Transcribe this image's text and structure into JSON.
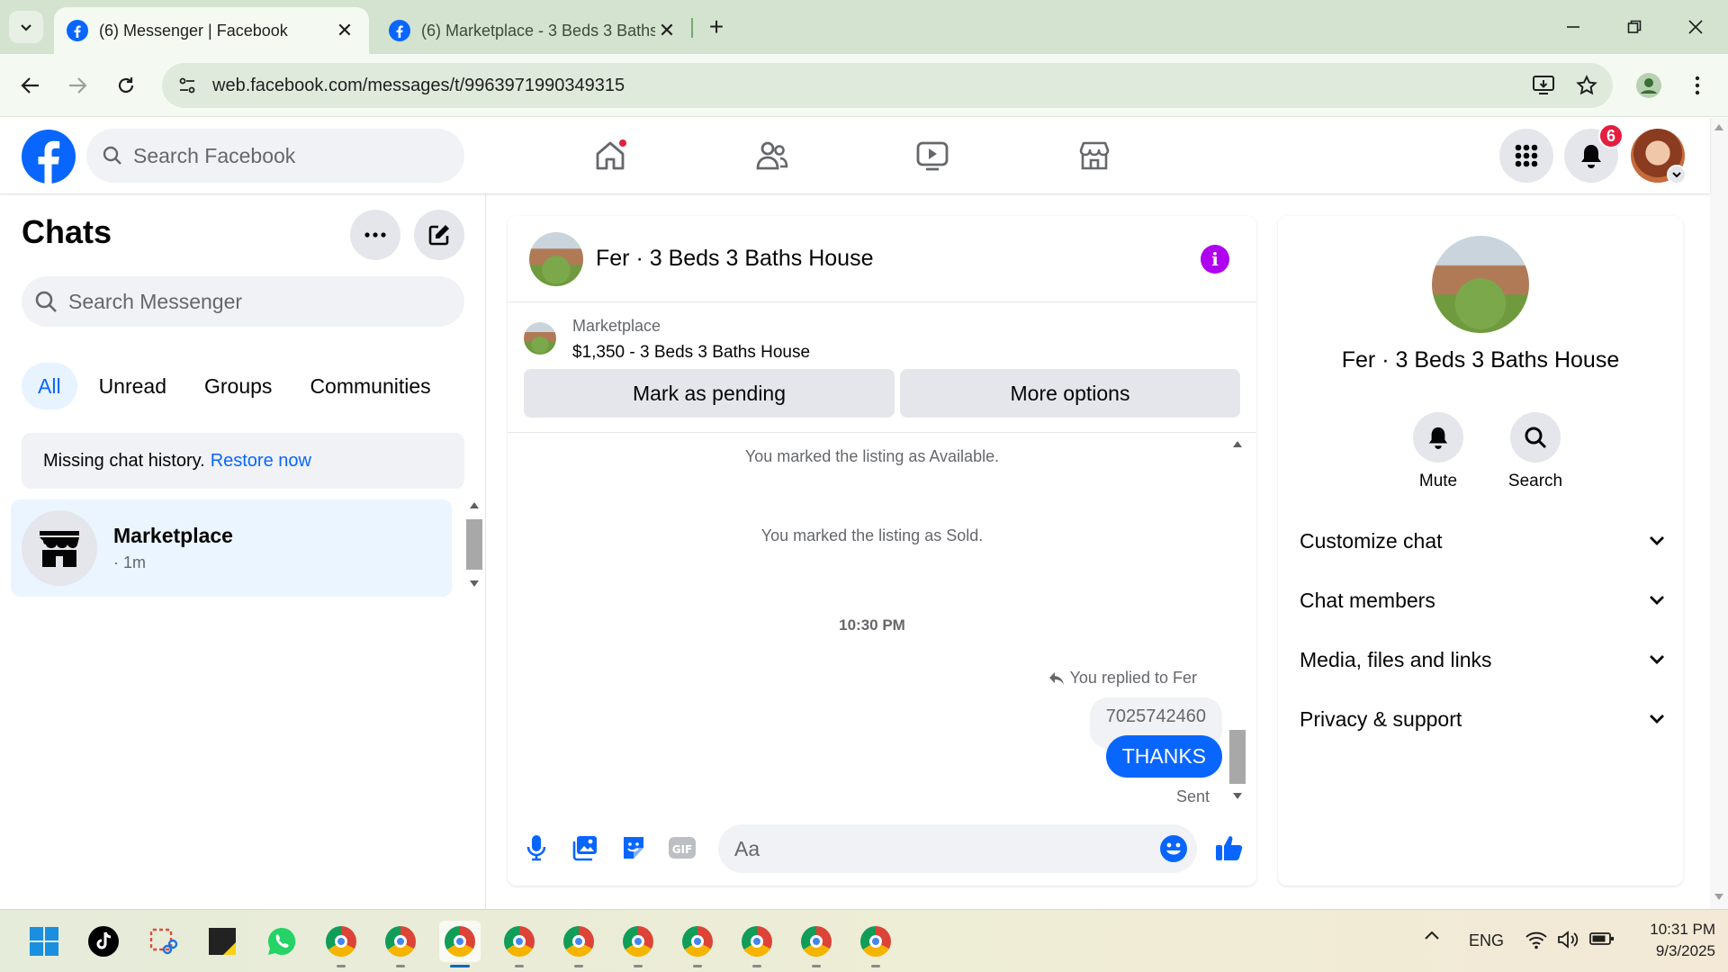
{
  "browser": {
    "tabs": [
      {
        "title": "(6) Messenger | Facebook",
        "active": true
      },
      {
        "title": "(6) Marketplace - 3 Beds 3 Baths",
        "active": false
      }
    ],
    "url": "web.facebook.com/messages/t/9963971990349315",
    "new_tab_symbol": "+"
  },
  "facebook": {
    "search_placeholder": "Search Facebook",
    "notification_count": "6",
    "accent_color": "#0866ff"
  },
  "chats": {
    "title": "Chats",
    "search_placeholder": "Search Messenger",
    "filters": [
      "All",
      "Unread",
      "Groups",
      "Communities"
    ],
    "notice_text": "Missing chat history.",
    "notice_link": "Restore now",
    "items": [
      {
        "name": "Marketplace",
        "time": "· 1m",
        "icon": "marketplace-store-icon"
      }
    ]
  },
  "conversation": {
    "title": "Fer · 3 Beds 3 Baths House",
    "listing_source": "Marketplace",
    "listing_price_title": "$1,350 - 3 Beds 3 Baths House",
    "buttons": {
      "pending": "Mark as pending",
      "more": "More options"
    },
    "messages": {
      "system_1": "You marked the listing as Available.",
      "system_2": "You marked the listing as Sold.",
      "timestamp": "10:30 PM",
      "replied_to": "You replied to Fer",
      "quoted_text": "7025742460",
      "sent_text": "THANKS",
      "status": "Sent"
    },
    "composer_placeholder": "Aa"
  },
  "info_panel": {
    "name": "Fer · 3 Beds 3 Baths House",
    "actions": [
      "Mute",
      "Search"
    ],
    "sections": [
      "Customize chat",
      "Chat members",
      "Media, files and links",
      "Privacy & support"
    ]
  },
  "taskbar": {
    "language": "ENG",
    "time": "10:31 PM",
    "date": "9/3/2025"
  }
}
